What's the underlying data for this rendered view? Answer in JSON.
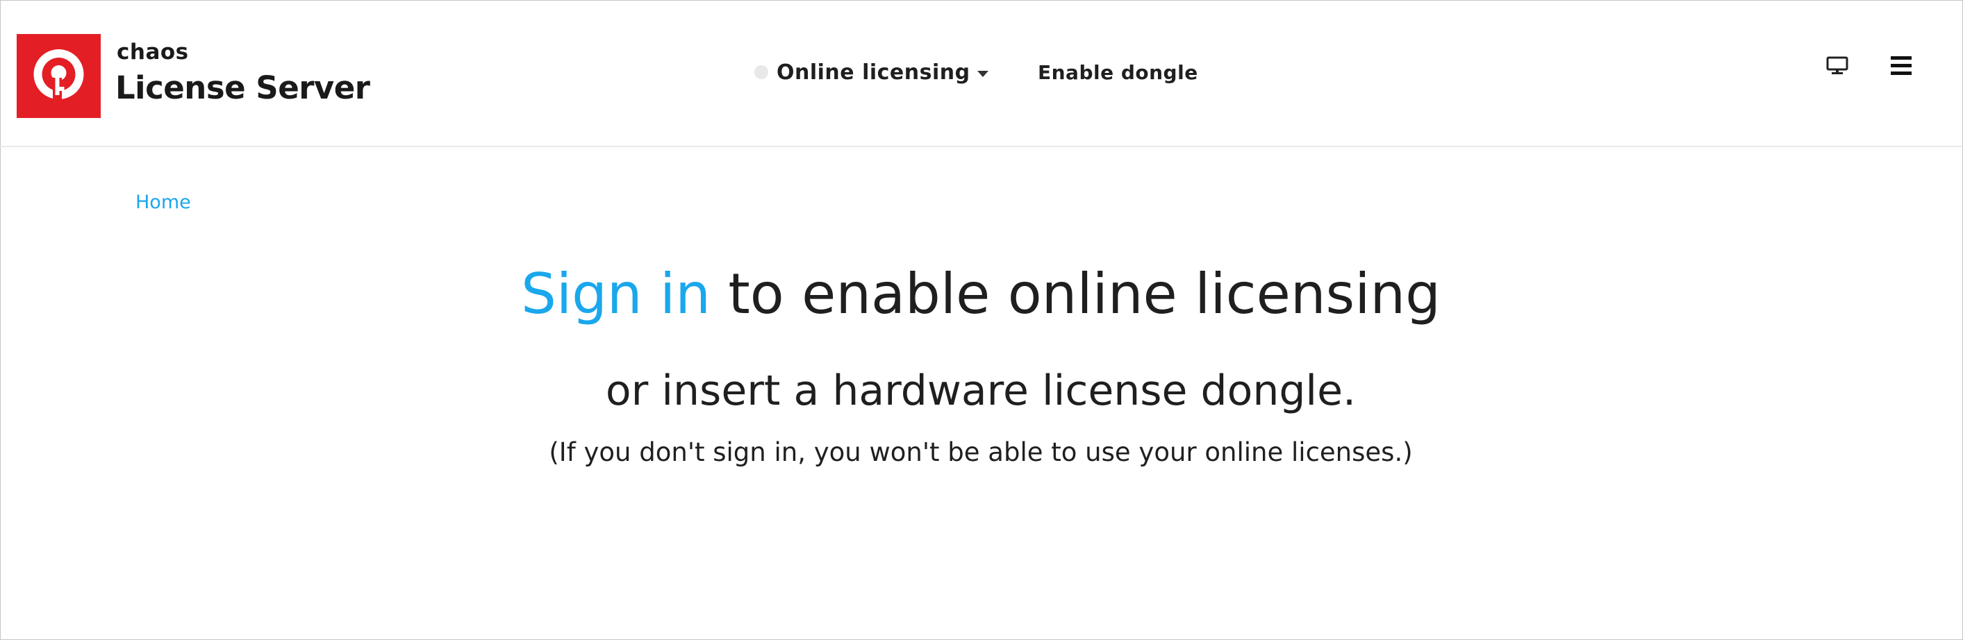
{
  "header": {
    "brand_small": "chaos",
    "brand_large": "License Server",
    "logo_icon": "key-icon",
    "nav": {
      "online_licensing_label": "Online licensing",
      "enable_dongle_label": "Enable dongle"
    },
    "icons": {
      "monitor": "monitor-icon",
      "menu": "hamburger-menu-icon"
    }
  },
  "breadcrumb": {
    "home": "Home"
  },
  "main": {
    "headline_link": "Sign in",
    "headline_rest": " to enable online licensing",
    "subline": "or insert a hardware license dongle.",
    "note": "(If you don't sign in, you won't be able to use your online licenses.)"
  },
  "colors": {
    "accent": "#1aa7ec",
    "brand_red": "#e41e25",
    "text": "#1f1f1f"
  }
}
